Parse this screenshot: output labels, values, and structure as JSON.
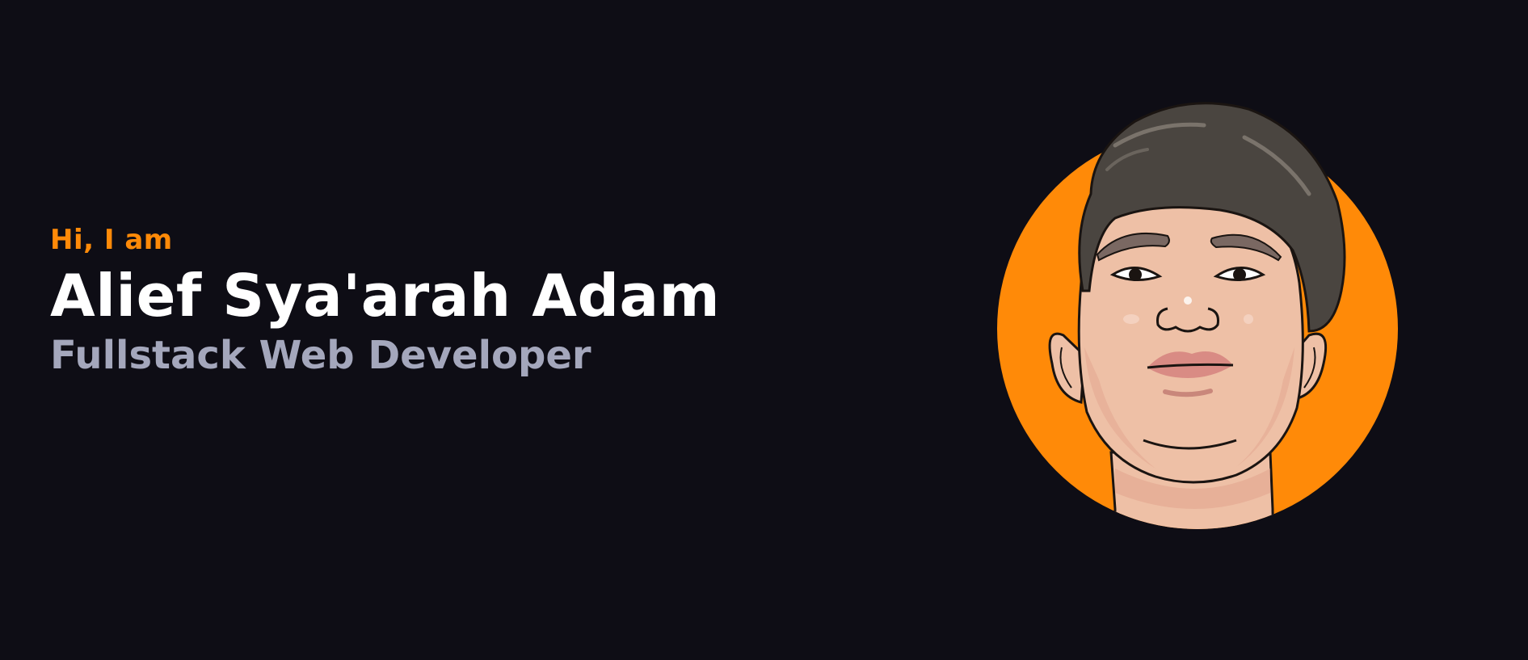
{
  "hero": {
    "greeting": "Hi, I am",
    "name": "Alief Sya'arah Adam",
    "role": "Fullstack Web Developer"
  },
  "theme": {
    "background": "#0e0d15",
    "accent": "#ff8a08",
    "heading": "#ffffff",
    "subheading": "#a4a7bc"
  },
  "avatar": {
    "icon": "cartoon-portrait",
    "background_color": "#ff8a08"
  }
}
